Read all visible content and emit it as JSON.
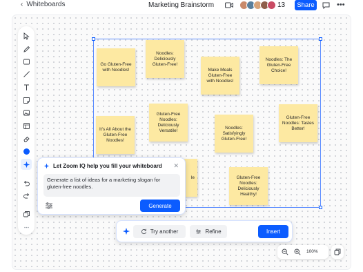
{
  "header": {
    "back_label": "Whiteboards",
    "title": "Marketing Brainstorm",
    "participant_count": "13",
    "share_label": "Share",
    "icons": [
      "chevron-left-icon",
      "video-icon",
      "chat-icon",
      "more-icon"
    ]
  },
  "participants": [
    {
      "color": "#c98a6b"
    },
    {
      "color": "#5a7f9c"
    },
    {
      "color": "#d8a47a"
    },
    {
      "color": "#8f5f4a"
    },
    {
      "color": "#c94b64"
    }
  ],
  "toolbar": {
    "tools": [
      "select",
      "pen",
      "rectangle",
      "line",
      "text",
      "sticky-note",
      "image",
      "template",
      "eraser",
      "color",
      "zoom-iq",
      "undo",
      "redo",
      "layers",
      "more"
    ],
    "active": "zoom-iq",
    "color_value": "#0b5cff"
  },
  "notes": [
    {
      "text": "Go Gluten-Free with Noodles!"
    },
    {
      "text": "Noodles: Deliciously Gluten-Free!"
    },
    {
      "text": "Make Meals Gluten-Free with Noodles!"
    },
    {
      "text": "Noodles: The Gluten-Free Choice!"
    },
    {
      "text": "It's All About the Gluten-Free Noodles!"
    },
    {
      "text": "Gluten-Free Noodles: Deliciously Versatile!"
    },
    {
      "text": "Noodles: Satisfyingly Gluten-Free!"
    },
    {
      "text": "Gluten-Free Noodles: Tastes Better!"
    },
    {
      "text": "le"
    },
    {
      "text": "Gluten-Free Noodles: Deliciously Healthy!"
    }
  ],
  "zoom_iq": {
    "title": "Let Zoom IQ help you fill your whiteboard",
    "prompt": "Generate a list of ideas for a marketing slogan for gluten-free noodles.",
    "generate_label": "Generate"
  },
  "actions": {
    "try_another_label": "Try another",
    "refine_label": "Refine",
    "insert_label": "Insert"
  },
  "zoom": {
    "value": "100%"
  },
  "colors": {
    "accent": "#0b5cff",
    "note": "#fde9a2"
  }
}
